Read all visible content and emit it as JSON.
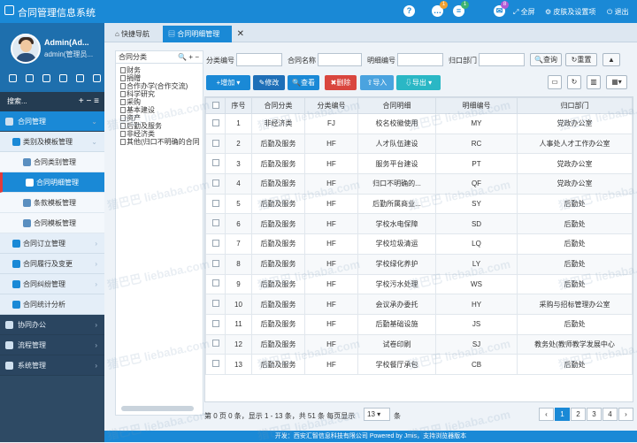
{
  "app": {
    "title": "合同管理信息系统"
  },
  "topbar": {
    "badges": [
      "1",
      "1",
      "8"
    ],
    "fullscreen": "全屏",
    "skin": "皮肤及设置项",
    "logout": "退出"
  },
  "user": {
    "name": "Admin(Ad...",
    "role": "admin(管理员..."
  },
  "search": {
    "label": "搜索..."
  },
  "menu": {
    "contract_mgmt": "合同管理",
    "category_template": "类别及模板管理",
    "contract_category": "合同类别管理",
    "contract_detail": "合同明细管理",
    "clause_template": "条款模板管理",
    "contract_template": "合同模板管理",
    "contract_order": "合同订立管理",
    "contract_exec": "合同履行及变更",
    "contract_dispute": "合同纠纷管理",
    "contract_stats": "合同统计分析",
    "collab_office": "协同办公",
    "process_mgmt": "流程管理",
    "system_mgmt": "系统管理"
  },
  "tabs": {
    "home": "快捷导航",
    "current": "合同明细管理"
  },
  "tree": {
    "header": "合同分类",
    "nodes": [
      "财务",
      "捐赠",
      "合作办学(合作交流)",
      "科学研究",
      "采购",
      "基本建设",
      "资产",
      "后勤及服务",
      "非经济类",
      "其他(归口不明确的合同"
    ]
  },
  "filters": {
    "category_code": "分类编号",
    "contract_name": "合同名称",
    "detail_code": "明细编号",
    "dept": "归口部门",
    "query": "查询",
    "reset": "重置"
  },
  "toolbar": {
    "add": "增加",
    "edit": "修改",
    "view": "查看",
    "delete": "删除",
    "import": "导入",
    "export": "导出"
  },
  "table": {
    "columns": [
      "序号",
      "合同分类",
      "分类编号",
      "合同明细",
      "明细编号",
      "归口部门"
    ],
    "rows": [
      [
        "1",
        "非经济类",
        "FJ",
        "校名校徽使用",
        "MY",
        "党政办公室"
      ],
      [
        "2",
        "后勤及服务",
        "HF",
        "人才队伍建设",
        "RC",
        "人事处人才工作办公室"
      ],
      [
        "3",
        "后勤及服务",
        "HF",
        "服务平台建设",
        "PT",
        "党政办公室"
      ],
      [
        "4",
        "后勤及服务",
        "HF",
        "归口不明确的...",
        "QF",
        "党政办公室"
      ],
      [
        "5",
        "后勤及服务",
        "HF",
        "后勤所属商业...",
        "SY",
        "后勤处"
      ],
      [
        "6",
        "后勤及服务",
        "HF",
        "学校水电保障",
        "SD",
        "后勤处"
      ],
      [
        "7",
        "后勤及服务",
        "HF",
        "学校垃圾清运",
        "LQ",
        "后勤处"
      ],
      [
        "8",
        "后勤及服务",
        "HF",
        "学校绿化养护",
        "LY",
        "后勤处"
      ],
      [
        "9",
        "后勤及服务",
        "HF",
        "学校污水处理",
        "WS",
        "后勤处"
      ],
      [
        "10",
        "后勤及服务",
        "HF",
        "会议承办委托",
        "HY",
        "采购与招标管理办公室"
      ],
      [
        "11",
        "后勤及服务",
        "HF",
        "后勤基础设施",
        "JS",
        "后勤处"
      ],
      [
        "12",
        "后勤及服务",
        "HF",
        "试卷印刷",
        "SJ",
        "教务处(教师教学发展中心"
      ],
      [
        "13",
        "后勤及服务",
        "HF",
        "学校餐厅承包",
        "CB",
        "后勤处"
      ]
    ]
  },
  "pager": {
    "text": "第 0 页 0 条，显示 1 - 13 条，共 51 条  每页显示",
    "page_size": "13",
    "suffix": "条",
    "pages": [
      "1",
      "2",
      "3",
      "4"
    ]
  },
  "footer": {
    "text": "开发：西安汇智信息科技有限公司 Powered by Jmis，支持浏览器版本"
  },
  "watermark": "猎巴巴 liebaba.com",
  "colors": {
    "primary": "#1a89d6",
    "edit": "#1e6fb8",
    "delete": "#d9463e",
    "import": "#4aa3df",
    "export": "#2ab7c5"
  }
}
